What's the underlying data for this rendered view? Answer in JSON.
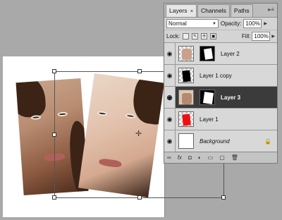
{
  "panel": {
    "tabs": [
      {
        "label": "Layers",
        "close": "×",
        "active": true
      },
      {
        "label": "Channels",
        "active": false
      },
      {
        "label": "Paths",
        "active": false
      }
    ],
    "menu_icon": "▸≡",
    "blend_mode": "Normal",
    "opacity_label": "Opacity:",
    "opacity_value": "100%",
    "lock_label": "Lock:",
    "fill_label": "Fill:",
    "fill_value": "100%",
    "layers": [
      {
        "name": "Layer 2",
        "visible": true,
        "selected": false
      },
      {
        "name": "Layer 1 copy",
        "visible": true,
        "selected": false
      },
      {
        "name": "Layer 3",
        "visible": true,
        "selected": true
      },
      {
        "name": "Layer 1",
        "visible": true,
        "selected": false
      },
      {
        "name": "Background",
        "visible": true,
        "selected": false,
        "locked": true
      }
    ],
    "footer_icons": [
      "link-icon",
      "fx-icon",
      "mask-icon",
      "adjustment-icon",
      "group-icon",
      "new-layer-icon",
      "trash-icon"
    ]
  },
  "colors": {
    "selected_row": "#3b3b3b",
    "layer1_fill": "#ee1111",
    "workspace": "#a9a9a9"
  }
}
